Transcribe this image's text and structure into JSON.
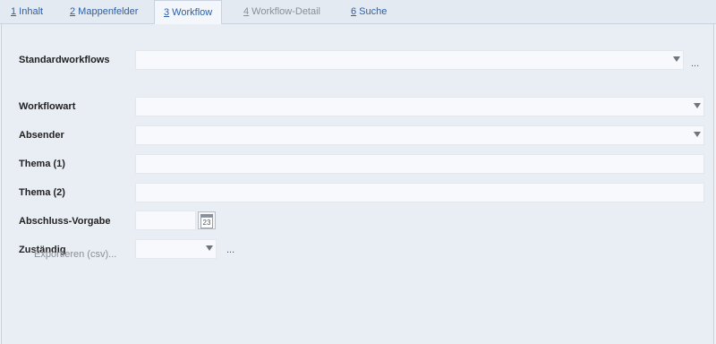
{
  "tabs": [
    {
      "key": "1",
      "rest": " Inhalt",
      "state": "normal"
    },
    {
      "key": "2",
      "rest": " Mappenfelder",
      "state": "normal"
    },
    {
      "key": "3",
      "rest": " Workflow",
      "state": "active"
    },
    {
      "key": "4",
      "rest": " Workflow-Detail",
      "state": "disabled"
    },
    {
      "key": "6",
      "rest": " Suche",
      "state": "normal"
    }
  ],
  "form": {
    "standardworkflows_label": "Standardworkflows",
    "standardworkflows_value": "",
    "standardworkflows_more": "...",
    "workflowart_label": "Workflowart",
    "workflowart_value": "",
    "absender_label": "Absender",
    "absender_value": "",
    "thema1_label": "Thema (1)",
    "thema1_value": "",
    "thema2_label": "Thema (2)",
    "thema2_value": "",
    "abschluss_label": "Abschluss-Vorgabe",
    "abschluss_value": "",
    "calendar_day": "23",
    "zustaendig_label": "Zuständig",
    "zustaendig_value": "",
    "zustaendig_more": "...",
    "export_label": "Exportieren (csv)..."
  },
  "icons": {
    "dropdown": "chevron-down-icon",
    "calendar": "calendar-icon"
  }
}
